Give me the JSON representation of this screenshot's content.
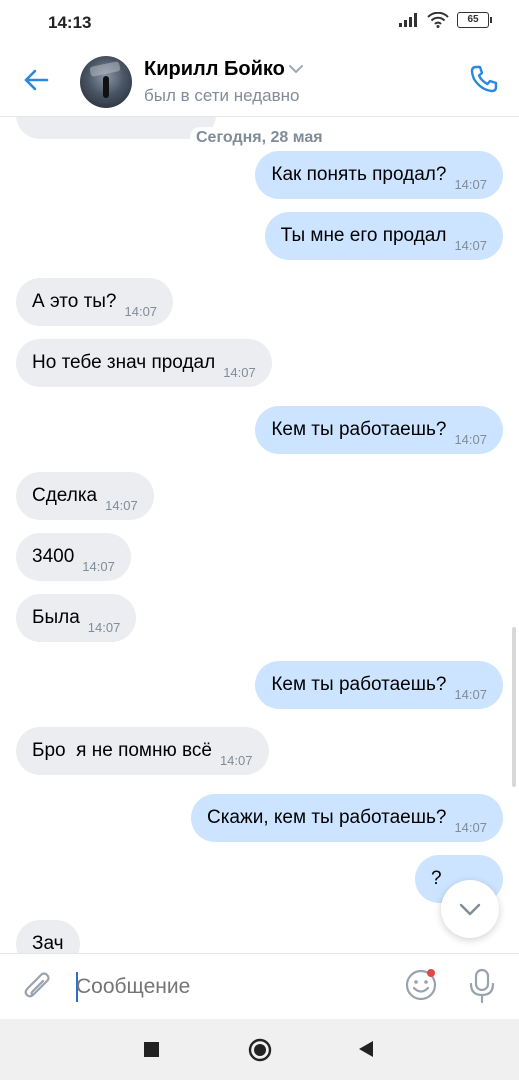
{
  "statusbar": {
    "time": "14:13",
    "battery": "65"
  },
  "header": {
    "contact_name": "Кирилл Бойко",
    "contact_status": "был в сети недавно"
  },
  "date_separator": "Сегодня, 28 мая",
  "messages": [
    {
      "dir": "out",
      "text": "Как понять продал?",
      "time": "14:07"
    },
    {
      "dir": "out",
      "text": "Ты мне его продал",
      "time": "14:07"
    },
    {
      "dir": "in",
      "text": "А это ты?",
      "time": "14:07"
    },
    {
      "dir": "in",
      "text": "Но тебе знач продал",
      "time": "14:07"
    },
    {
      "dir": "out",
      "text": "Кем ты работаешь?",
      "time": "14:07"
    },
    {
      "dir": "in",
      "text": "Сделка",
      "time": "14:07"
    },
    {
      "dir": "in",
      "text": "3400",
      "time": "14:07"
    },
    {
      "dir": "in",
      "text": "Была",
      "time": "14:07"
    },
    {
      "dir": "out",
      "text": "Кем ты работаешь?",
      "time": "14:07"
    },
    {
      "dir": "in",
      "text": "Бро  я не помню всё",
      "time": "14:07"
    },
    {
      "dir": "out",
      "text": "Скажи, кем ты работаешь?",
      "time": "14:07"
    },
    {
      "dir": "out",
      "text": "?",
      "time": ""
    },
    {
      "dir": "in",
      "text": "Зач",
      "time": ""
    }
  ],
  "composer": {
    "placeholder": "Сообщение"
  },
  "colors": {
    "accent": "#2a88e0",
    "incoming_bubble": "#ebedf0",
    "outgoing_bubble": "#cce4ff",
    "secondary_text": "#818c99"
  },
  "icons": {
    "back": "arrow-left-icon",
    "call": "phone-icon",
    "attach": "paperclip-icon",
    "emoji": "smile-icon",
    "mic": "microphone-icon",
    "scroll": "chevron-down-icon"
  }
}
